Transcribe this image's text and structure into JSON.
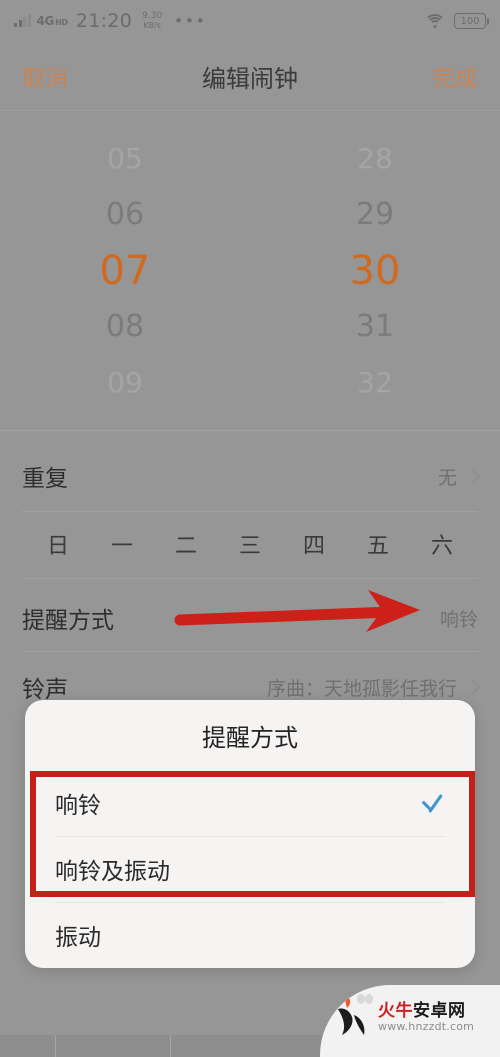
{
  "status_bar": {
    "network_type": "4G",
    "network_sup": "HD",
    "time": "21:20",
    "speed_value": "9.30",
    "speed_unit": "KB/s",
    "overflow_dots": "•••",
    "wifi_icon": "wifi-icon",
    "battery_level": "100"
  },
  "nav_bar": {
    "cancel_label": "取消",
    "title": "编辑闹钟",
    "done_label": "完成",
    "accent_color": "#c98455"
  },
  "time_picker": {
    "hours": [
      "05",
      "06",
      "07",
      "08",
      "09"
    ],
    "minutes": [
      "28",
      "29",
      "30",
      "31",
      "32"
    ],
    "selected_hour": "07",
    "selected_minute": "30",
    "selected_color": "#cf6a20"
  },
  "rows": {
    "repeat": {
      "label": "重复",
      "value": "无"
    },
    "weekdays": [
      "日",
      "一",
      "二",
      "三",
      "四",
      "五",
      "六"
    ],
    "reminder_mode": {
      "label": "提醒方式",
      "value": "响铃"
    },
    "ringtone": {
      "label": "铃声",
      "value": "序曲：天地孤影任我行"
    }
  },
  "annotation": {
    "arrow_color": "#cc2018",
    "highlight_box_color": "#c4201a"
  },
  "dialog": {
    "title": "提醒方式",
    "options": [
      {
        "label": "响铃",
        "selected": true
      },
      {
        "label": "响铃及振动",
        "selected": false
      },
      {
        "label": "振动",
        "selected": false
      }
    ],
    "check_color": "#3d96d2"
  },
  "watermark": {
    "title_red": "火牛",
    "title_black": "安卓网",
    "url": "www.hnzzdt.com"
  }
}
